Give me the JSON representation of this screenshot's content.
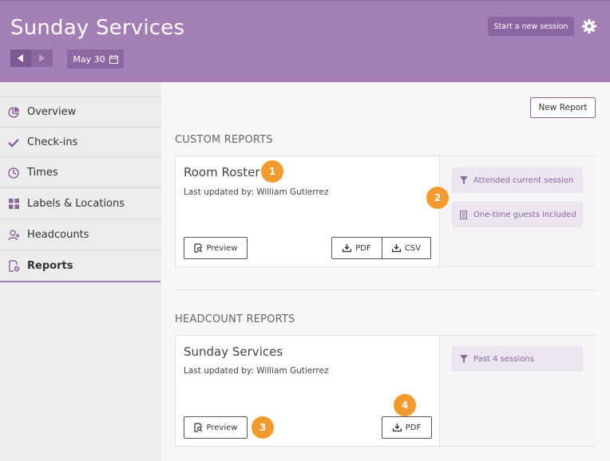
{
  "header": {
    "title": "Sunday Services",
    "date": "May 30",
    "start_session_label": "Start a new session",
    "accent_color": "#a37fb5"
  },
  "sidebar": {
    "items": [
      {
        "label": "Overview",
        "icon": "pie-chart-icon",
        "active": false
      },
      {
        "label": "Check-ins",
        "icon": "checkmark-icon",
        "active": false
      },
      {
        "label": "Times",
        "icon": "clock-icon",
        "active": false
      },
      {
        "label": "Labels & Locations",
        "icon": "grid-icon",
        "active": false
      },
      {
        "label": "Headcounts",
        "icon": "add-person-icon",
        "active": false
      },
      {
        "label": "Reports",
        "icon": "report-gear-icon",
        "active": true
      }
    ]
  },
  "main": {
    "new_report_label": "New Report",
    "custom_section_title": "CUSTOM REPORTS",
    "headcount_section_title": "HEADCOUNT REPORTS",
    "custom_card": {
      "title": "Room Roster",
      "subtitle": "Last updated by: William Gutierrez",
      "preview_label": "Preview",
      "pdf_label": "PDF",
      "csv_label": "CSV",
      "filters": [
        "Attended current session",
        "One-time guests included"
      ]
    },
    "headcount_card": {
      "title": "Sunday Services",
      "subtitle": "Last updated by: William Gutierrez",
      "preview_label": "Preview",
      "pdf_label": "PDF",
      "filters": [
        "Past 4 sessions"
      ]
    }
  },
  "badges": [
    "1",
    "2",
    "3",
    "4"
  ],
  "badge_color": "#f29a2e"
}
